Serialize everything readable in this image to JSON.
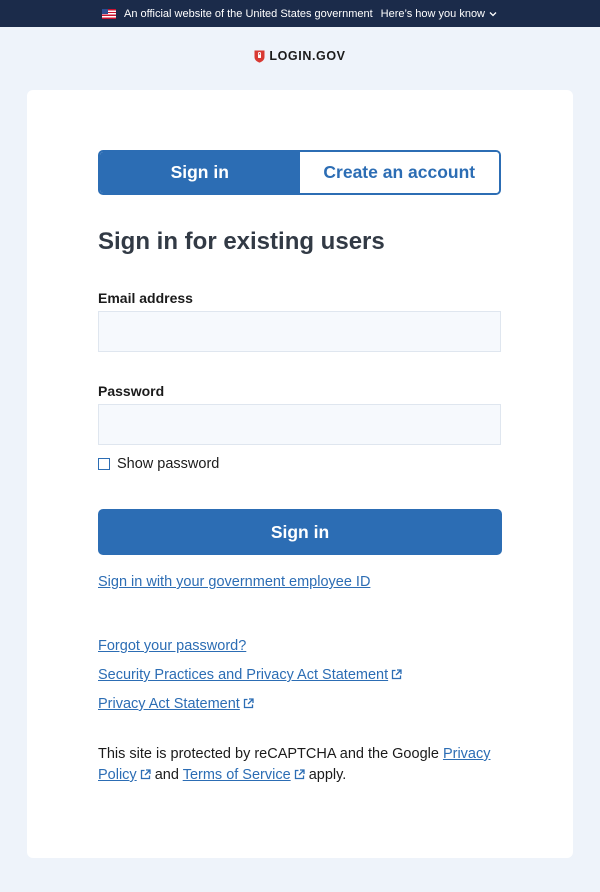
{
  "banner": {
    "text": "An official website of the United States government",
    "link": "Here’s how you know"
  },
  "logo": {
    "text": "LOGIN.GOV"
  },
  "tabs": [
    {
      "label": "Sign in",
      "active": true
    },
    {
      "label": "Create an account",
      "active": false
    }
  ],
  "page": {
    "heading": "Sign in for existing users"
  },
  "form": {
    "email_label": "Email address",
    "email_value": "",
    "password_label": "Password",
    "password_value": "",
    "show_password_label": "Show password",
    "submit_label": "Sign in"
  },
  "links": {
    "piv": "Sign in with your government employee ID",
    "forgot": "Forgot your password?",
    "security": "Security Practices and Privacy Act Statement",
    "privacy_act": "Privacy Act Statement"
  },
  "recaptcha": {
    "prefix": "This site is protected by reCAPTCHA and the Google ",
    "privacy_policy": "Privacy Policy",
    "and": " and ",
    "terms": "Terms of Service",
    "suffix": " apply."
  },
  "colors": {
    "primary": "#2c6db4",
    "banner_bg": "#1b2b4a",
    "page_bg": "#eef3fa",
    "logo_shield": "#d83933"
  },
  "icons": [
    "us-flag-icon",
    "chevron-down-icon",
    "login-shield-icon",
    "external-link-icon"
  ]
}
